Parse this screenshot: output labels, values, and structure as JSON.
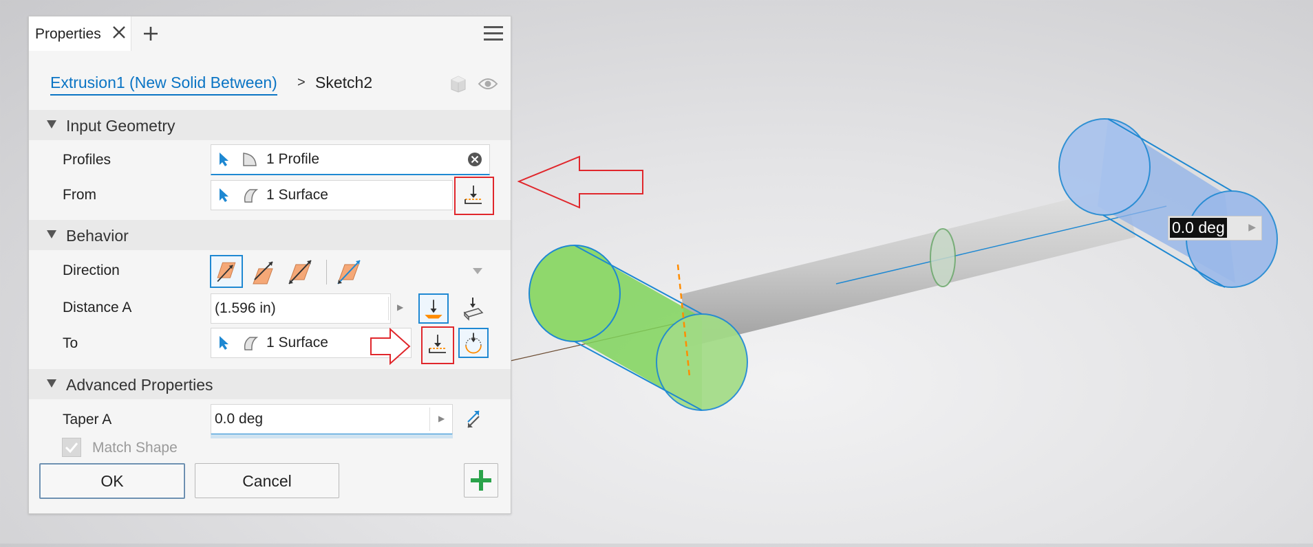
{
  "panel": {
    "tab_label": "Properties",
    "breadcrumb": {
      "feature": "Extrusion1 (New Solid Between)",
      "separator": ">",
      "current": "Sketch2"
    }
  },
  "sections": {
    "input_geometry": "Input Geometry",
    "behavior": "Behavior",
    "advanced": "Advanced Properties"
  },
  "input_geometry": {
    "profiles_label": "Profiles",
    "profiles_value": "1 Profile",
    "from_label": "From",
    "from_value": "1 Surface"
  },
  "behavior": {
    "direction_label": "Direction",
    "distance_label": "Distance A",
    "distance_value": "(1.596 in)",
    "to_label": "To",
    "to_value": "1 Surface"
  },
  "advanced": {
    "taper_label": "Taper A",
    "taper_value": "0.0 deg",
    "match_shape_label": "Match Shape",
    "match_shape_checked": true
  },
  "buttons": {
    "ok": "OK",
    "cancel": "Cancel"
  },
  "viewport": {
    "angle_value": "0.0 deg"
  },
  "colors": {
    "accent": "#1e88d2",
    "link": "#0a74c4",
    "callout_red": "#e0262b",
    "profile_green": "#7fd35a",
    "target_blue": "#8fb2e8",
    "add_green": "#2aa34a"
  }
}
